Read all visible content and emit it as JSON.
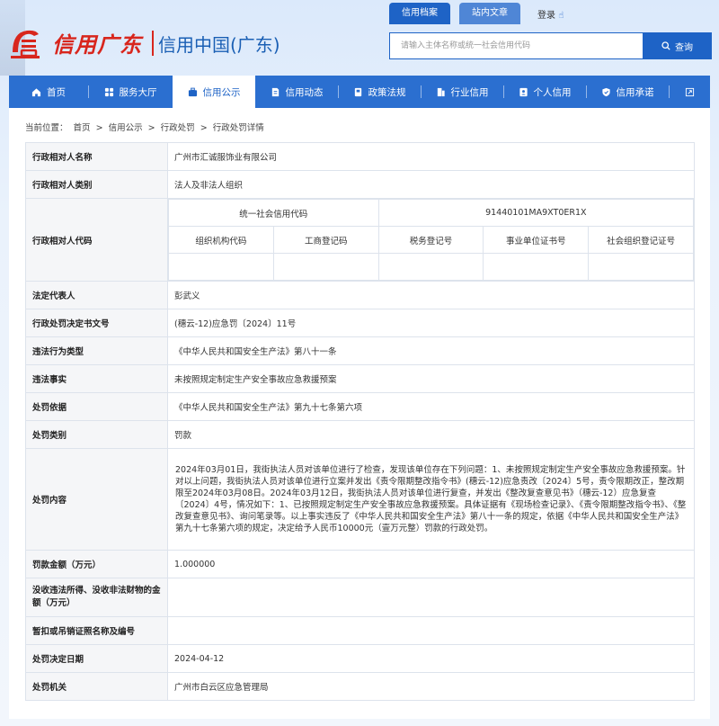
{
  "header": {
    "logo_script": "信用广东",
    "logo_text": "信用中国(广东)",
    "tabs": [
      {
        "label": "信用档案",
        "active": true
      },
      {
        "label": "站内文章",
        "active": false
      }
    ],
    "login": "登录",
    "search": {
      "placeholder": "请输入主体名称或统一社会信用代码",
      "button": "查询"
    }
  },
  "nav": {
    "items": [
      {
        "label": "首页",
        "icon": "home-icon"
      },
      {
        "label": "服务大厅",
        "icon": "grid-icon"
      },
      {
        "label": "信用公示",
        "icon": "briefcase-icon",
        "active": true
      },
      {
        "label": "信用动态",
        "icon": "document-icon"
      },
      {
        "label": "政策法规",
        "icon": "book-icon"
      },
      {
        "label": "行业信用",
        "icon": "building-icon"
      },
      {
        "label": "个人信用",
        "icon": "id-card-icon"
      },
      {
        "label": "信用承诺",
        "icon": "shield-icon"
      }
    ]
  },
  "breadcrumb": {
    "prefix": "当前位置：",
    "items": [
      "首页",
      "信用公示",
      "行政处罚",
      "行政处罚详情"
    ],
    "sep": ">"
  },
  "detail": {
    "name_label": "行政相对人名称",
    "name": "广州市汇诚服饰业有限公司",
    "type_label": "行政相对人类别",
    "type": "法人及非法人组织",
    "code_label": "行政相对人代码",
    "uscc_label": "统一社会信用代码",
    "uscc": "91440101MA9XT0ER1X",
    "code_headers": [
      "组织机构代码",
      "工商登记码",
      "税务登记号",
      "事业单位证书号",
      "社会组织登记证号"
    ],
    "legal_rep_label": "法定代表人",
    "legal_rep": "彭武义",
    "doc_no_label": "行政处罚决定书文号",
    "doc_no": "(穗云-12)应急罚〔2024〕11号",
    "violation_type_label": "违法行为类型",
    "violation_type": "《中华人民共和国安全生产法》第八十一条",
    "facts_label": "违法事实",
    "facts": "未按照规定制定生产安全事故应急救援预案",
    "basis_label": "处罚依据",
    "basis": "《中华人民共和国安全生产法》第九十七条第六项",
    "category_label": "处罚类别",
    "category": "罚款",
    "content_label": "处罚内容",
    "content": "2024年03月01日，我街执法人员对该单位进行了检查，发现该单位存在下列问题：1、未按照规定制定生产安全事故应急救援预案。针对以上问题，我街执法人员对该单位进行立案并发出《责令限期整改指令书》(穗云-12)应急责改〔2024〕5号，责令限期改正，整改期限至2024年03月08日。2024年03月12日，我街执法人员对该单位进行复查，并发出《整改复查意见书》（穗云-12）应急复查〔2024〕4号，情况如下：1、已按照规定制定生产安全事故应急救援预案。具体证据有《现场检查记录》、《责令限期整改指令书》、《整改复查意见书》、询问笔录等。以上事实违反了《中华人民共和国安全生产法》第八十一条的规定，依据《中华人民共和国安全生产法》第九十七条第六项的规定，决定给予人民币10000元（壹万元整）罚款的行政处罚。",
    "fine_label": "罚款金额（万元）",
    "fine": "1.000000",
    "confiscation_label": "没收违法所得、没收非法财物的金额（万元）",
    "confiscation": "",
    "license_label": "暂扣或吊销证照名称及编号",
    "license": "",
    "date_label": "处罚决定日期",
    "date": "2024-04-12",
    "authority_label": "处罚机关",
    "authority": "广州市白云区应急管理局"
  },
  "colors": {
    "primary": "#1e63c6",
    "nav": "#2b6fd0",
    "brand_red": "#d8261d"
  }
}
